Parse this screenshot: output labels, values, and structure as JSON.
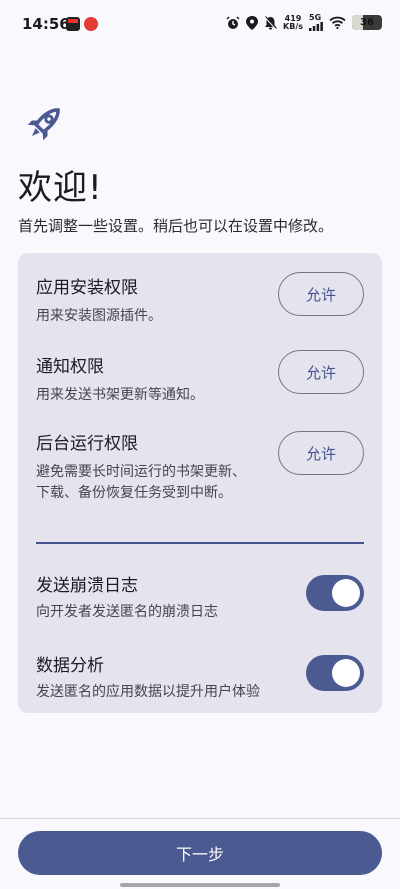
{
  "status_bar": {
    "time": "14:56",
    "net_speed_value": "419",
    "net_speed_unit": "KB/s",
    "network_type": "5G",
    "battery_level": "36"
  },
  "header": {
    "icon": "rocket-icon",
    "title": "欢迎!",
    "subtitle": "首先调整一些设置。稍后也可以在设置中修改。"
  },
  "permissions": [
    {
      "title": "应用安装权限",
      "description": "用来安装图源插件。",
      "button": "允许"
    },
    {
      "title": "通知权限",
      "description": "用来发送书架更新等通知。",
      "button": "允许"
    },
    {
      "title": "后台运行权限",
      "description": "避免需要长时间运行的书架更新、下载、备份恢复任务受到中断。",
      "button": "允许"
    }
  ],
  "toggles": [
    {
      "title": "发送崩溃日志",
      "description": "向开发者发送匿名的崩溃日志",
      "enabled": true
    },
    {
      "title": "数据分析",
      "description": "发送匿名的应用数据以提升用户体验",
      "enabled": true
    }
  ],
  "footer": {
    "next_label": "下一步"
  },
  "colors": {
    "accent": "#4c5a92",
    "card": "#e5e4ee",
    "background": "#f9f8fd"
  }
}
